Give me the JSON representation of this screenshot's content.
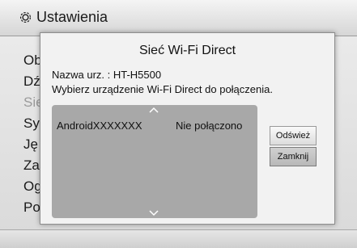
{
  "header": {
    "title": "Ustawienia",
    "icon": "gear-icon"
  },
  "menu": {
    "items": [
      {
        "label": "Ob",
        "disabled": false
      },
      {
        "label": "Dź",
        "disabled": false
      },
      {
        "label": "Sie",
        "disabled": true
      },
      {
        "label": "Sy",
        "disabled": false
      },
      {
        "label": "Ję",
        "disabled": false
      },
      {
        "label": "Za",
        "disabled": false
      },
      {
        "label": "Og",
        "disabled": false
      },
      {
        "label": "Po",
        "disabled": false
      }
    ]
  },
  "dialog": {
    "title": "Sieć Wi-Fi Direct",
    "device_name": "Nazwa urz. : HT-H5500",
    "prompt": "Wybierz urządzenie Wi-Fi Direct do połączenia.",
    "devices": [
      {
        "name": "AndroidXXXXXXX",
        "status": "Nie połączono"
      }
    ],
    "buttons": {
      "refresh": "Odśwież",
      "close": "Zamknij"
    }
  }
}
